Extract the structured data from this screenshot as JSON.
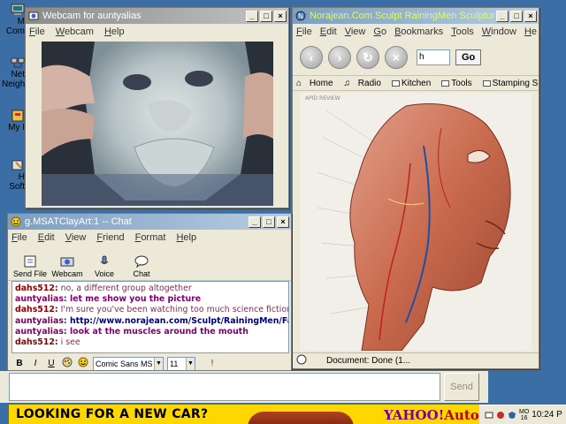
{
  "desktop": {
    "icons": [
      {
        "label": "M\nCom",
        "icon": "my-computer-icon"
      },
      {
        "label": "Net\nNeigh",
        "icon": "network-neighborhood-icon"
      },
      {
        "label": "My I",
        "icon": "my-documents-icon"
      },
      {
        "label": "H\nSoft",
        "icon": "software-icon"
      }
    ]
  },
  "webcam": {
    "title": "Webcam for auntyalias",
    "menu": [
      "File",
      "Webcam",
      "Help"
    ]
  },
  "browser": {
    "title": "Norajean.Com Sculpt RainingMen Sculpture",
    "menu": [
      "File",
      "Edit",
      "View",
      "Go",
      "Bookmarks",
      "Tools",
      "Window",
      "He"
    ],
    "url_value": "h",
    "go_label": "Go",
    "personal_toolbar": [
      "Home",
      "Radio",
      "Kitchen",
      "Tools",
      "Stamping Sites"
    ],
    "page_corner_text": "APID REVIEW",
    "status": "Document: Done (1..."
  },
  "chat": {
    "title": "g.MSATClayArt:1 -- Chat",
    "menu": [
      "File",
      "Edit",
      "View",
      "Friend",
      "Format",
      "Help"
    ],
    "toolbar": [
      "Send File",
      "Webcam",
      "Voice",
      "Chat"
    ],
    "messages": [
      {
        "sender": "dahs512:",
        "text": " no, a different group altogether",
        "kind": "a"
      },
      {
        "sender": "auntyalias:",
        "text": " let me show you the picture",
        "kind": "b"
      },
      {
        "sender": "dahs512:",
        "text": " I'm sure you've been watching too much science fiction",
        "kind": "a"
      },
      {
        "sender": "auntyalias:",
        "text": " http://www.norajean.com/Sculpt/RainingMen/Face",
        "kind": "link"
      },
      {
        "sender": "auntyalias:",
        "text": " look at the muscles around the mouth",
        "kind": "b"
      },
      {
        "sender": "dahs512:",
        "text": " i see",
        "kind": "a"
      }
    ],
    "format": {
      "bold": "B",
      "italic": "I",
      "underline": "U",
      "font": "Comic Sans MS",
      "size": "11"
    },
    "input_value": "",
    "send_label": "Send"
  },
  "ad": {
    "headline": "LOOKING FOR A NEW CAR?",
    "brand": "YAHOO!",
    "brand_suffix": "Auto"
  },
  "tray": {
    "day": "MO\n16",
    "time": "10:24 P"
  },
  "colors": {
    "desktop": "#3a6ea5",
    "ad_background": "#ffd700",
    "chat_sender_a": "#8b0000",
    "chat_sender_b": "#800060"
  }
}
